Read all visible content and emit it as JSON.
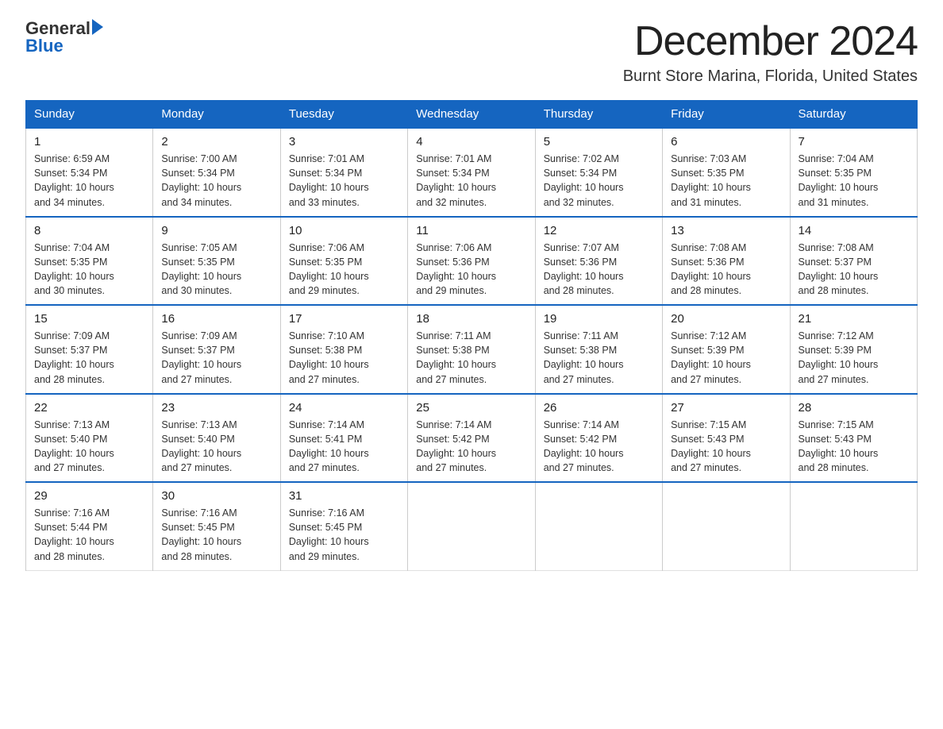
{
  "logo": {
    "text_black": "General",
    "text_blue": "Blue"
  },
  "title": "December 2024",
  "subtitle": "Burnt Store Marina, Florida, United States",
  "days_of_week": [
    "Sunday",
    "Monday",
    "Tuesday",
    "Wednesday",
    "Thursday",
    "Friday",
    "Saturday"
  ],
  "weeks": [
    [
      {
        "day": "1",
        "sunrise": "6:59 AM",
        "sunset": "5:34 PM",
        "daylight": "10 hours and 34 minutes."
      },
      {
        "day": "2",
        "sunrise": "7:00 AM",
        "sunset": "5:34 PM",
        "daylight": "10 hours and 34 minutes."
      },
      {
        "day": "3",
        "sunrise": "7:01 AM",
        "sunset": "5:34 PM",
        "daylight": "10 hours and 33 minutes."
      },
      {
        "day": "4",
        "sunrise": "7:01 AM",
        "sunset": "5:34 PM",
        "daylight": "10 hours and 32 minutes."
      },
      {
        "day": "5",
        "sunrise": "7:02 AM",
        "sunset": "5:34 PM",
        "daylight": "10 hours and 32 minutes."
      },
      {
        "day": "6",
        "sunrise": "7:03 AM",
        "sunset": "5:35 PM",
        "daylight": "10 hours and 31 minutes."
      },
      {
        "day": "7",
        "sunrise": "7:04 AM",
        "sunset": "5:35 PM",
        "daylight": "10 hours and 31 minutes."
      }
    ],
    [
      {
        "day": "8",
        "sunrise": "7:04 AM",
        "sunset": "5:35 PM",
        "daylight": "10 hours and 30 minutes."
      },
      {
        "day": "9",
        "sunrise": "7:05 AM",
        "sunset": "5:35 PM",
        "daylight": "10 hours and 30 minutes."
      },
      {
        "day": "10",
        "sunrise": "7:06 AM",
        "sunset": "5:35 PM",
        "daylight": "10 hours and 29 minutes."
      },
      {
        "day": "11",
        "sunrise": "7:06 AM",
        "sunset": "5:36 PM",
        "daylight": "10 hours and 29 minutes."
      },
      {
        "day": "12",
        "sunrise": "7:07 AM",
        "sunset": "5:36 PM",
        "daylight": "10 hours and 28 minutes."
      },
      {
        "day": "13",
        "sunrise": "7:08 AM",
        "sunset": "5:36 PM",
        "daylight": "10 hours and 28 minutes."
      },
      {
        "day": "14",
        "sunrise": "7:08 AM",
        "sunset": "5:37 PM",
        "daylight": "10 hours and 28 minutes."
      }
    ],
    [
      {
        "day": "15",
        "sunrise": "7:09 AM",
        "sunset": "5:37 PM",
        "daylight": "10 hours and 28 minutes."
      },
      {
        "day": "16",
        "sunrise": "7:09 AM",
        "sunset": "5:37 PM",
        "daylight": "10 hours and 27 minutes."
      },
      {
        "day": "17",
        "sunrise": "7:10 AM",
        "sunset": "5:38 PM",
        "daylight": "10 hours and 27 minutes."
      },
      {
        "day": "18",
        "sunrise": "7:11 AM",
        "sunset": "5:38 PM",
        "daylight": "10 hours and 27 minutes."
      },
      {
        "day": "19",
        "sunrise": "7:11 AM",
        "sunset": "5:38 PM",
        "daylight": "10 hours and 27 minutes."
      },
      {
        "day": "20",
        "sunrise": "7:12 AM",
        "sunset": "5:39 PM",
        "daylight": "10 hours and 27 minutes."
      },
      {
        "day": "21",
        "sunrise": "7:12 AM",
        "sunset": "5:39 PM",
        "daylight": "10 hours and 27 minutes."
      }
    ],
    [
      {
        "day": "22",
        "sunrise": "7:13 AM",
        "sunset": "5:40 PM",
        "daylight": "10 hours and 27 minutes."
      },
      {
        "day": "23",
        "sunrise": "7:13 AM",
        "sunset": "5:40 PM",
        "daylight": "10 hours and 27 minutes."
      },
      {
        "day": "24",
        "sunrise": "7:14 AM",
        "sunset": "5:41 PM",
        "daylight": "10 hours and 27 minutes."
      },
      {
        "day": "25",
        "sunrise": "7:14 AM",
        "sunset": "5:42 PM",
        "daylight": "10 hours and 27 minutes."
      },
      {
        "day": "26",
        "sunrise": "7:14 AM",
        "sunset": "5:42 PM",
        "daylight": "10 hours and 27 minutes."
      },
      {
        "day": "27",
        "sunrise": "7:15 AM",
        "sunset": "5:43 PM",
        "daylight": "10 hours and 27 minutes."
      },
      {
        "day": "28",
        "sunrise": "7:15 AM",
        "sunset": "5:43 PM",
        "daylight": "10 hours and 28 minutes."
      }
    ],
    [
      {
        "day": "29",
        "sunrise": "7:16 AM",
        "sunset": "5:44 PM",
        "daylight": "10 hours and 28 minutes."
      },
      {
        "day": "30",
        "sunrise": "7:16 AM",
        "sunset": "5:45 PM",
        "daylight": "10 hours and 28 minutes."
      },
      {
        "day": "31",
        "sunrise": "7:16 AM",
        "sunset": "5:45 PM",
        "daylight": "10 hours and 29 minutes."
      },
      null,
      null,
      null,
      null
    ]
  ],
  "labels": {
    "sunrise": "Sunrise:",
    "sunset": "Sunset:",
    "daylight": "Daylight:"
  }
}
